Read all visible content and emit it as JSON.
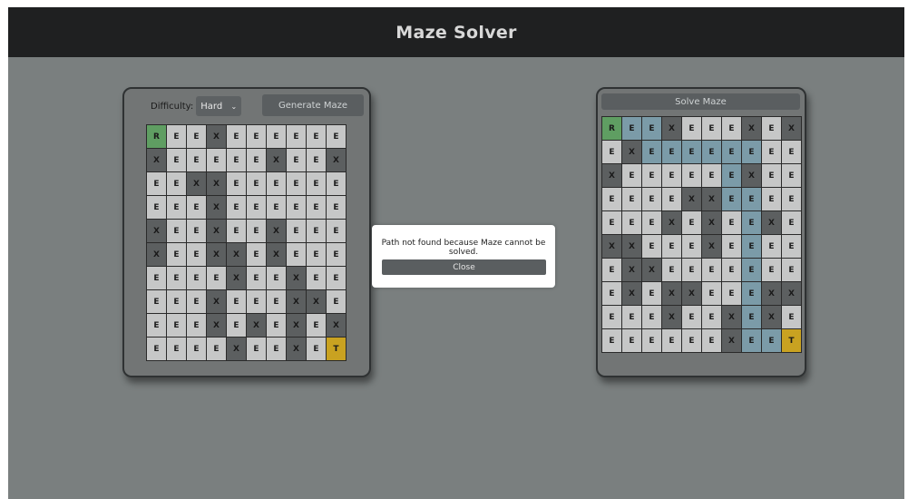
{
  "header": {
    "title": "Maze Solver"
  },
  "generator": {
    "difficulty_label": "Difficulty:",
    "difficulty_value": "Hard",
    "generate_label": "Generate Maze",
    "grid": [
      [
        "R",
        "E",
        "E",
        "X",
        "E",
        "E",
        "E",
        "E",
        "E",
        "E"
      ],
      [
        "X",
        "E",
        "E",
        "E",
        "E",
        "E",
        "X",
        "E",
        "E",
        "X"
      ],
      [
        "E",
        "E",
        "X",
        "X",
        "E",
        "E",
        "E",
        "E",
        "E",
        "E"
      ],
      [
        "E",
        "E",
        "E",
        "X",
        "E",
        "E",
        "E",
        "E",
        "E",
        "E"
      ],
      [
        "X",
        "E",
        "E",
        "X",
        "E",
        "E",
        "X",
        "E",
        "E",
        "E"
      ],
      [
        "X",
        "E",
        "E",
        "X",
        "X",
        "E",
        "X",
        "E",
        "E",
        "E"
      ],
      [
        "E",
        "E",
        "E",
        "E",
        "X",
        "E",
        "E",
        "X",
        "E",
        "E"
      ],
      [
        "E",
        "E",
        "E",
        "X",
        "E",
        "E",
        "E",
        "X",
        "X",
        "E"
      ],
      [
        "E",
        "E",
        "E",
        "X",
        "E",
        "X",
        "E",
        "X",
        "E",
        "X"
      ],
      [
        "E",
        "E",
        "E",
        "E",
        "X",
        "E",
        "E",
        "X",
        "E",
        "T"
      ]
    ]
  },
  "solver": {
    "solve_label": "Solve Maze",
    "grid": [
      [
        "R",
        "E",
        "E",
        "X",
        "E",
        "E",
        "E",
        "X",
        "E",
        "X"
      ],
      [
        "E",
        "X",
        "E",
        "E",
        "E",
        "E",
        "E",
        "E",
        "E",
        "E"
      ],
      [
        "X",
        "E",
        "E",
        "E",
        "E",
        "E",
        "E",
        "X",
        "E",
        "E"
      ],
      [
        "E",
        "E",
        "E",
        "E",
        "X",
        "X",
        "E",
        "E",
        "E",
        "E"
      ],
      [
        "E",
        "E",
        "E",
        "X",
        "E",
        "X",
        "E",
        "E",
        "X",
        "E"
      ],
      [
        "X",
        "X",
        "E",
        "E",
        "E",
        "X",
        "E",
        "E",
        "E",
        "E"
      ],
      [
        "E",
        "X",
        "X",
        "E",
        "E",
        "E",
        "E",
        "E",
        "E",
        "E"
      ],
      [
        "E",
        "X",
        "E",
        "X",
        "X",
        "E",
        "E",
        "E",
        "X",
        "X"
      ],
      [
        "E",
        "E",
        "E",
        "X",
        "E",
        "E",
        "X",
        "E",
        "X",
        "E"
      ],
      [
        "E",
        "E",
        "E",
        "E",
        "E",
        "E",
        "X",
        "E",
        "E",
        "T"
      ]
    ],
    "path_cells": [
      [
        0,
        0
      ],
      [
        0,
        1
      ],
      [
        0,
        2
      ],
      [
        1,
        2
      ],
      [
        1,
        3
      ],
      [
        1,
        4
      ],
      [
        1,
        5
      ],
      [
        1,
        6
      ],
      [
        1,
        7
      ],
      [
        2,
        6
      ],
      [
        3,
        6
      ],
      [
        3,
        7
      ],
      [
        4,
        7
      ],
      [
        5,
        7
      ],
      [
        6,
        7
      ],
      [
        7,
        7
      ],
      [
        8,
        7
      ],
      [
        9,
        7
      ],
      [
        9,
        8
      ],
      [
        9,
        9
      ]
    ],
    "colors": {
      "path": "#7b9ba8",
      "start": "#5f9e62",
      "target": "#c9a221",
      "wall": "#5c5f60",
      "empty": "#c6c7c7"
    }
  },
  "modal": {
    "message": "Path not found because Maze cannot be solved.",
    "close_label": "Close"
  }
}
